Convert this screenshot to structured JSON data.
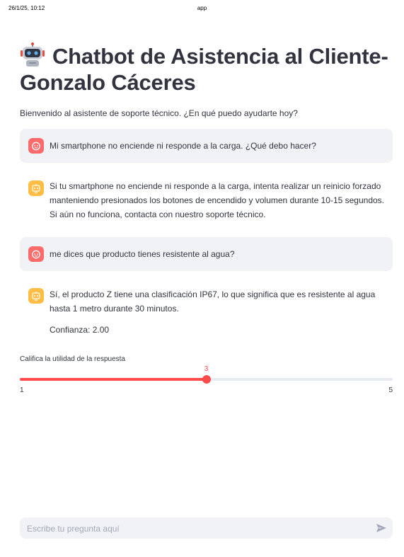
{
  "print_header": {
    "date": "26/1/25, 10:12",
    "title": "app"
  },
  "page": {
    "title_line1": "Chatbot de Asistencia al Cliente-",
    "title_line2": "Gonzalo Cáceres",
    "title_icon": "robot-face-icon",
    "subtitle": "Bienvenido al asistente de soporte técnico. ¿En qué puedo ayudarte hoy?"
  },
  "messages": [
    {
      "role": "user",
      "avatar_icon": "user-face-icon",
      "text": "Mi smartphone no enciende ni responde a la carga. ¿Qué debo hacer?"
    },
    {
      "role": "assistant",
      "avatar_icon": "robot-icon",
      "text": "Si tu smartphone no enciende ni responde a la carga, intenta realizar un reinicio forzado manteniendo presionados los botones de encendido y volumen durante 10-15 segundos. Si aún no funciona, contacta con nuestro soporte técnico."
    },
    {
      "role": "user",
      "avatar_icon": "user-face-icon",
      "text": "me dices que producto tienes resistente al agua?"
    },
    {
      "role": "assistant",
      "avatar_icon": "robot-icon",
      "text": "Sí, el producto Z tiene una clasificación IP67, lo que significa que es resistente al agua hasta 1 metro durante 30 minutos.",
      "extra": "Confianza: 2.00"
    }
  ],
  "rating": {
    "label": "Califica la utilidad de la respuesta",
    "min": 1,
    "max": 5,
    "value": 3,
    "min_label": "1",
    "max_label": "5",
    "value_label": "3",
    "accent_color": "#ff4b4b"
  },
  "chat_input": {
    "placeholder": "Escribe tu pregunta aquí",
    "send_icon": "send-icon"
  },
  "colors": {
    "user_avatar": "#ff6b6b",
    "bot_avatar": "#ffbd45",
    "user_bubble": "#f0f2f6"
  }
}
